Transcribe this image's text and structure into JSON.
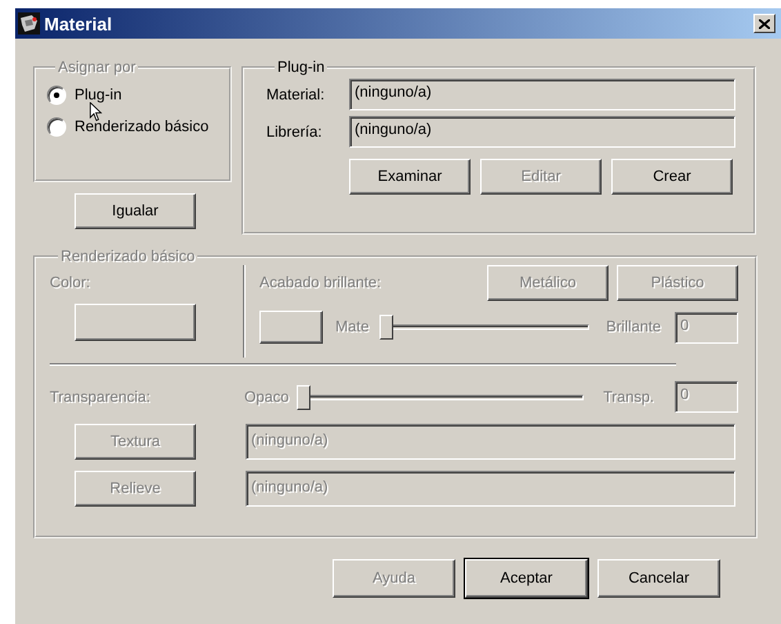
{
  "window": {
    "title": "Material"
  },
  "assign_group": {
    "legend": "Asignar por",
    "disabled": true,
    "options": [
      {
        "label": "Plug-in",
        "selected": true
      },
      {
        "label": "Renderizado básico",
        "selected": false
      }
    ]
  },
  "match_button": {
    "label": "Igualar",
    "disabled": false
  },
  "plugin_group": {
    "legend": "Plug-in",
    "fields": [
      {
        "label": "Material:",
        "value": "(ninguno/a)"
      },
      {
        "label": "Librería:",
        "value": "(ninguno/a)"
      }
    ],
    "buttons": [
      {
        "label": "Examinar",
        "disabled": false
      },
      {
        "label": "Editar",
        "disabled": true
      },
      {
        "label": "Crear",
        "disabled": false
      }
    ]
  },
  "basic_group": {
    "legend": "Renderizado básico",
    "disabled": true,
    "color_label": "Color:",
    "gloss_label": "Acabado brillante:",
    "gloss_buttons": [
      "Metálico",
      "Plástico"
    ],
    "gloss_slider": {
      "min_label": "Mate",
      "max_label": "Brillante",
      "level": 0,
      "value": "0"
    },
    "transparency_label": "Transparencia:",
    "transparency_slider": {
      "min_label": "Opaco",
      "max_label": "Transp.",
      "level": 0,
      "value": "0"
    },
    "maps": [
      {
        "button": "Textura",
        "value": "(ninguno/a)"
      },
      {
        "button": "Relieve",
        "value": "(ninguno/a)"
      }
    ]
  },
  "footer_buttons": [
    {
      "label": "Ayuda",
      "disabled": true,
      "default": false
    },
    {
      "label": "Aceptar",
      "disabled": false,
      "default": true
    },
    {
      "label": "Cancelar",
      "disabled": false,
      "default": false
    }
  ]
}
